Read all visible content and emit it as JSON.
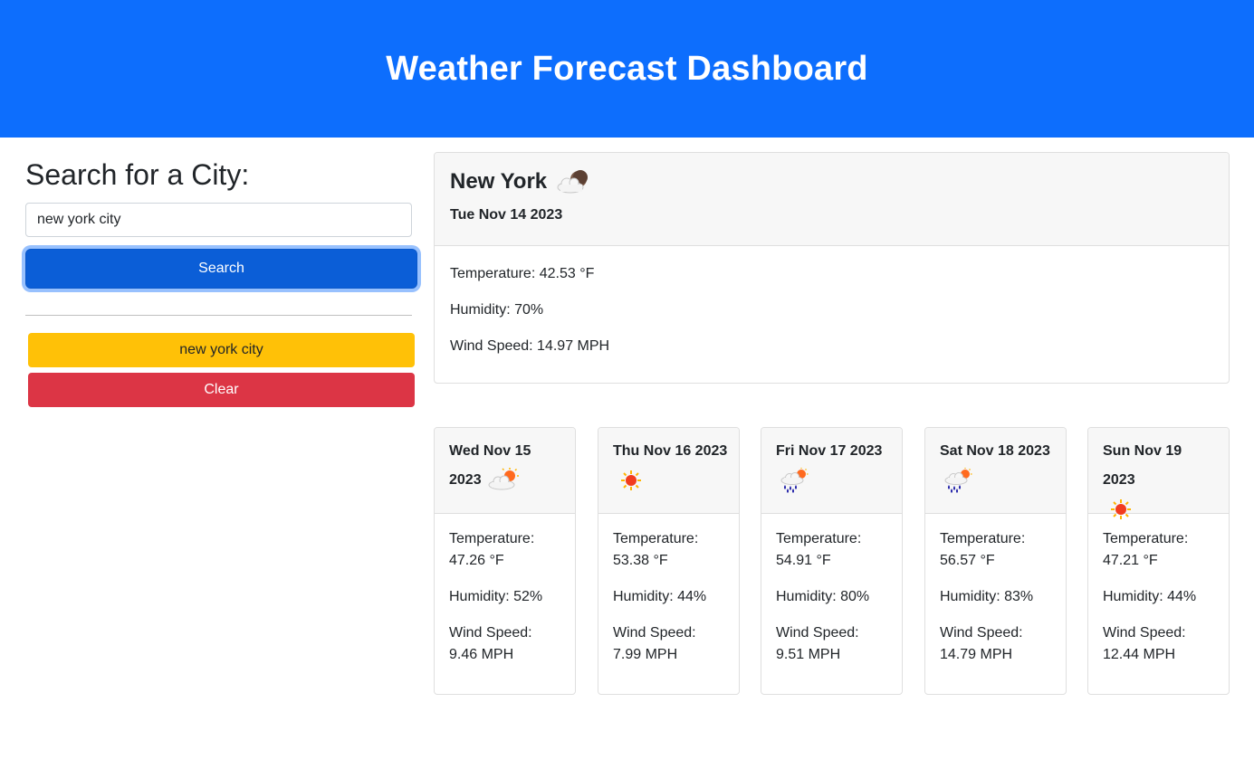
{
  "header": {
    "title": "Weather Forecast Dashboard"
  },
  "colors": {
    "primary": "#0d6efd",
    "warning": "#ffc107",
    "danger": "#dc3545"
  },
  "search": {
    "title": "Search for a City:",
    "input_value": "new york city",
    "button_label": "Search"
  },
  "history": {
    "items": [
      "new york city"
    ],
    "clear_label": "Clear"
  },
  "current": {
    "city": "New York",
    "icon": "cloud-moon-icon",
    "date": "Tue Nov 14 2023",
    "temperature": "Temperature: 42.53 °F",
    "humidity": "Humidity: 70%",
    "wind": "Wind Speed: 14.97 MPH"
  },
  "forecast": [
    {
      "date": "Wed Nov 15 2023",
      "icon": "partly-cloudy-icon",
      "temp_label": "Temperature:",
      "temp": "47.26 °F",
      "humidity": "Humidity: 52%",
      "wind_label": "Wind Speed:",
      "wind": "9.46 MPH"
    },
    {
      "date": "Thu Nov 16 2023",
      "icon": "sun-icon",
      "temp_label": "Temperature:",
      "temp": "53.38 °F",
      "humidity": "Humidity: 44%",
      "wind_label": "Wind Speed:",
      "wind": "7.99 MPH"
    },
    {
      "date": "Fri Nov 17 2023",
      "icon": "rain-sun-icon",
      "temp_label": "Temperature:",
      "temp": "54.91 °F",
      "humidity": "Humidity: 80%",
      "wind_label": "Wind Speed:",
      "wind": "9.51 MPH"
    },
    {
      "date": "Sat Nov 18 2023",
      "icon": "rain-sun-icon",
      "temp_label": "Temperature:",
      "temp": "56.57 °F",
      "humidity": "Humidity: 83%",
      "wind_label": "Wind Speed:",
      "wind": "14.79 MPH"
    },
    {
      "date": "Sun Nov 19 2023",
      "icon": "sun-icon",
      "temp_label": "Temperature:",
      "temp": "47.21 °F",
      "humidity": "Humidity: 44%",
      "wind_label": "Wind Speed:",
      "wind": "12.44 MPH"
    }
  ]
}
